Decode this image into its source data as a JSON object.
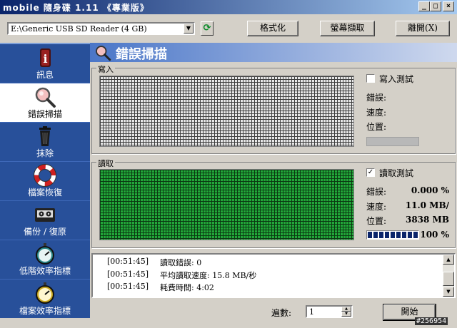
{
  "window": {
    "title": "mobile 隨身碟",
    "version": "1.11 《專業版》",
    "min_label": "_",
    "max_label": "□",
    "close_label": "×"
  },
  "toolbar": {
    "device": "E:\\Generic USB SD Reader (4 GB)",
    "format_label": "格式化",
    "screenshot_label": "螢幕擷取",
    "exit_label": "離開(X)"
  },
  "sidebar": {
    "items": [
      {
        "label": "訊息",
        "icon": "info-icon"
      },
      {
        "label": "錯誤掃描",
        "icon": "magnifier-icon"
      },
      {
        "label": "抹除",
        "icon": "trash-icon"
      },
      {
        "label": "檔案恢復",
        "icon": "lifebuoy-icon"
      },
      {
        "label": "備份 / 復原",
        "icon": "tape-icon"
      },
      {
        "label": "低階效率指標",
        "icon": "stopwatch-icon"
      },
      {
        "label": "檔案效率指標",
        "icon": "stopwatch-icon"
      }
    ]
  },
  "header": {
    "title": "錯誤掃描"
  },
  "write_group": {
    "label": "寫入",
    "test_label": "寫入測試",
    "checked": false,
    "error_label": "錯誤:",
    "speed_label": "速度:",
    "position_label": "位置:",
    "error_value": "",
    "speed_value": "",
    "position_value": "",
    "progress": 0
  },
  "read_group": {
    "label": "讀取",
    "test_label": "讀取測試",
    "checked": true,
    "error_label": "錯誤:",
    "speed_label": "速度:",
    "position_label": "位置:",
    "error_value": "0.000 %",
    "speed_value": "11.0 MB/",
    "position_value": "3838 MB",
    "progress": 1.0,
    "percent_text": "100 %"
  },
  "log": {
    "rows": [
      {
        "time": "[00:51:45]",
        "msg": "讀取錯誤: 0"
      },
      {
        "time": "[00:51:45]",
        "msg": "平均讀取速度: 15.8 MB/秒"
      },
      {
        "time": "[00:51:45]",
        "msg": "耗費時間: 4:02"
      }
    ]
  },
  "bottom": {
    "count_label": "遍數:",
    "count_value": "1",
    "start_label": "開始"
  },
  "watermark": "#256954",
  "colors": {
    "sidebar_bg": "#28509a",
    "read_grid": "#22a83a",
    "progress": "#0a246a"
  }
}
